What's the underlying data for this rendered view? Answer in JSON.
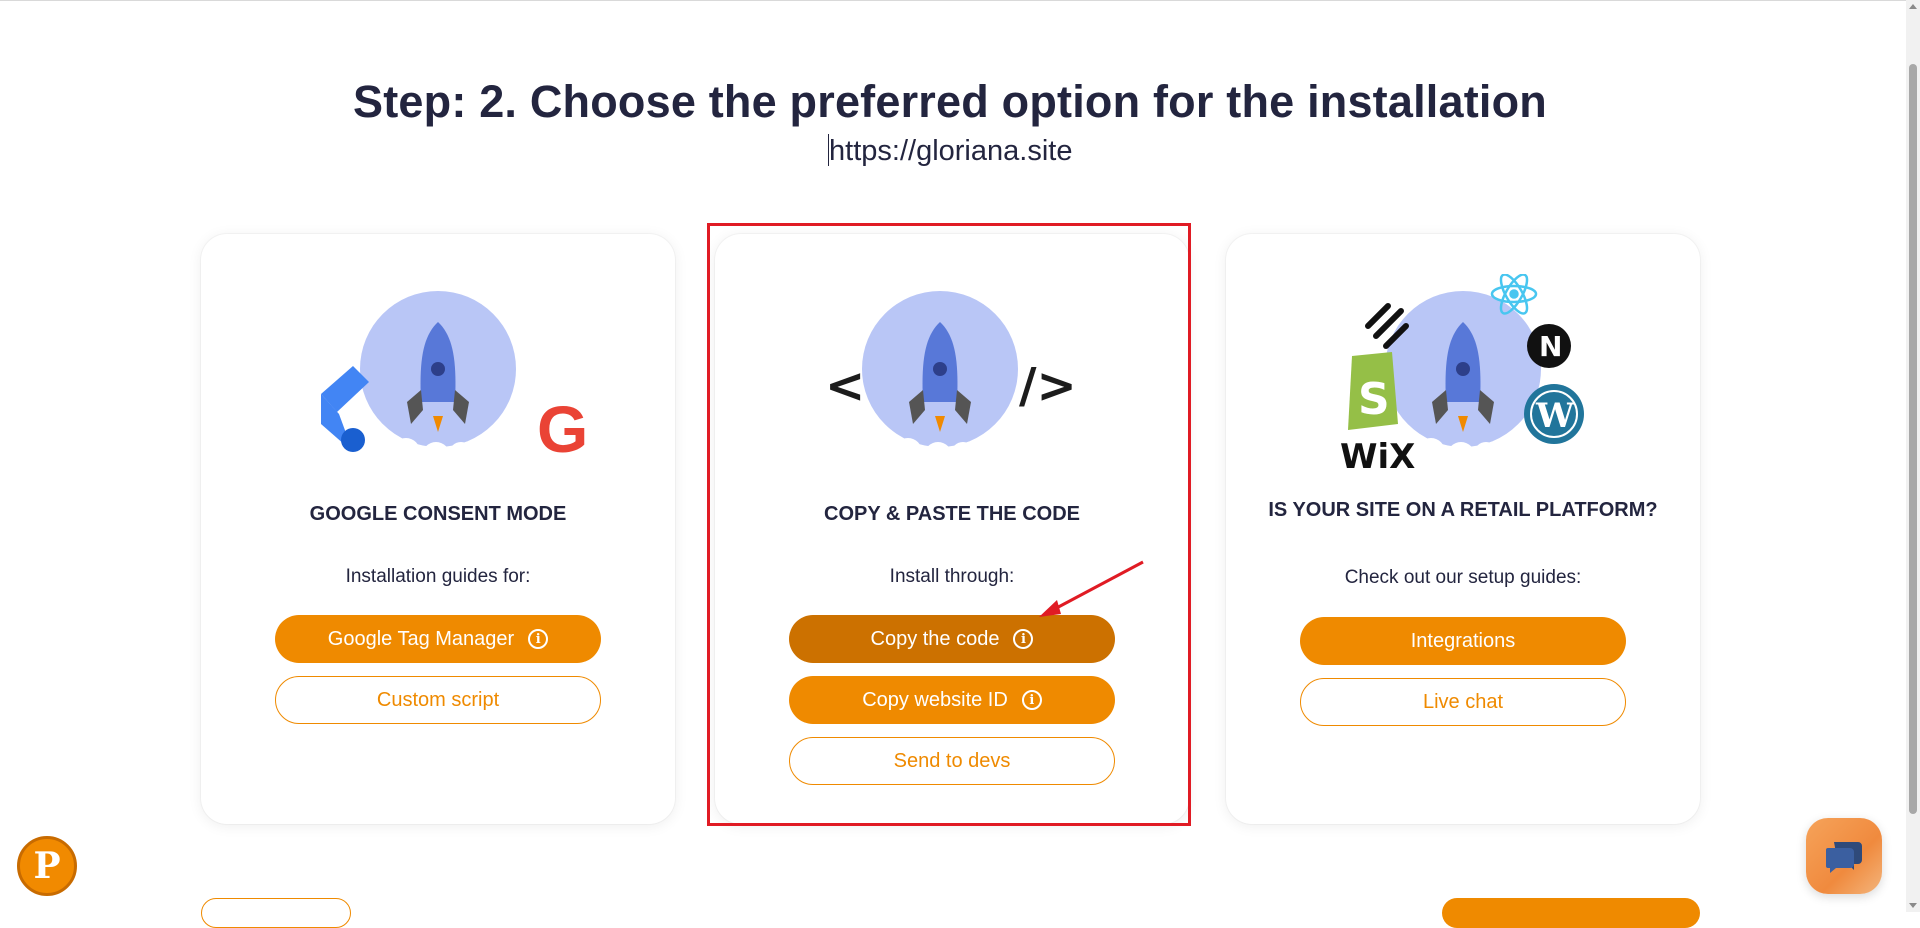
{
  "header": {
    "title": "Step: 2. Choose the preferred option for the installation",
    "url": "https://gloriana.site"
  },
  "cards": [
    {
      "title": "GOOGLE CONSENT MODE",
      "subtitle": "Installation guides for:",
      "buttons": [
        "Google Tag Manager",
        "Custom script"
      ]
    },
    {
      "title": "COPY & PASTE THE CODE",
      "subtitle": "Install through:",
      "buttons": [
        "Copy the code",
        "Copy website ID",
        "Send to devs"
      ]
    },
    {
      "title": "IS YOUR SITE ON A RETAIL PLATFORM?",
      "subtitle": "Check out our setup guides:",
      "buttons": [
        "Integrations",
        "Live chat"
      ]
    }
  ],
  "illustration_labels": {
    "code_open": "<",
    "code_close": "/>",
    "wix": "WiX",
    "next": "N",
    "google": "G",
    "wordpress": "W",
    "p_badge": "P"
  },
  "icons": [
    "info-icon",
    "rocket-icon",
    "chat-bubble-icon",
    "shopify-icon",
    "react-icon",
    "squarespace-icon",
    "wordpress-icon",
    "nextjs-icon",
    "google-tag-manager-icon",
    "google-icon"
  ],
  "colors": {
    "accent": "#ef8a00",
    "accent_active": "#cc7100",
    "highlight": "#e01b24",
    "heading": "#23253f"
  }
}
